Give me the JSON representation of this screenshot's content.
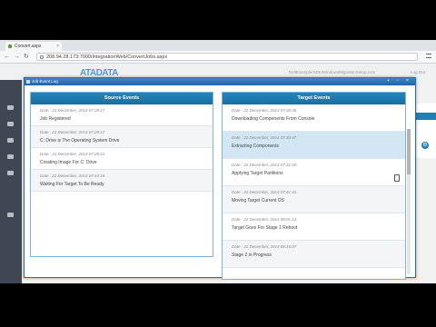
{
  "browser": {
    "tab_title": "Convert.aspx",
    "url": "208.94.28.173:7000/IntegrationWeb/ConvertJobs.aspx",
    "header_info": "DellExample/SDK/WindowsMigrationSetup.com",
    "header_right": "Log Out"
  },
  "app": {
    "logo": "ATADATA"
  },
  "modal": {
    "title": "Job Event Log",
    "source_panel": {
      "header": "Source Events",
      "events": [
        {
          "date": "Date : 22 December, 2014 07:28:17",
          "text": "Job Registered"
        },
        {
          "date": "Date : 22 December, 2014 07:28:17",
          "text": "C: Drive is The Operating System Drive"
        },
        {
          "date": "Date : 22 December, 2014 07:28:21",
          "text": "Creating Image For C: Drive"
        },
        {
          "date": "Date : 22 December, 2014 07:44:16",
          "text": "Waiting For Target To Be Ready"
        }
      ]
    },
    "target_panel": {
      "header": "Target Events",
      "events": [
        {
          "date": "Date : 22 December, 2014 07:30:36",
          "text": "Downloading Components From Console"
        },
        {
          "date": "Date : 22 December, 2014 07:30:47",
          "text": "Extracting Components"
        },
        {
          "date": "Date : 22 December, 2014 07:31:00",
          "text": "Applying Target Partitions"
        },
        {
          "date": "Date : 22 December, 2014 07:41:41",
          "text": "Moving Target Current OS"
        },
        {
          "date": "Date : 22 December, 2014 08:01:13",
          "text": "Target Goes For Stage 1 Reboot"
        },
        {
          "date": "Date : 22 December, 2014 08:15:07",
          "text": "Stage 2 in Progress"
        }
      ]
    }
  }
}
